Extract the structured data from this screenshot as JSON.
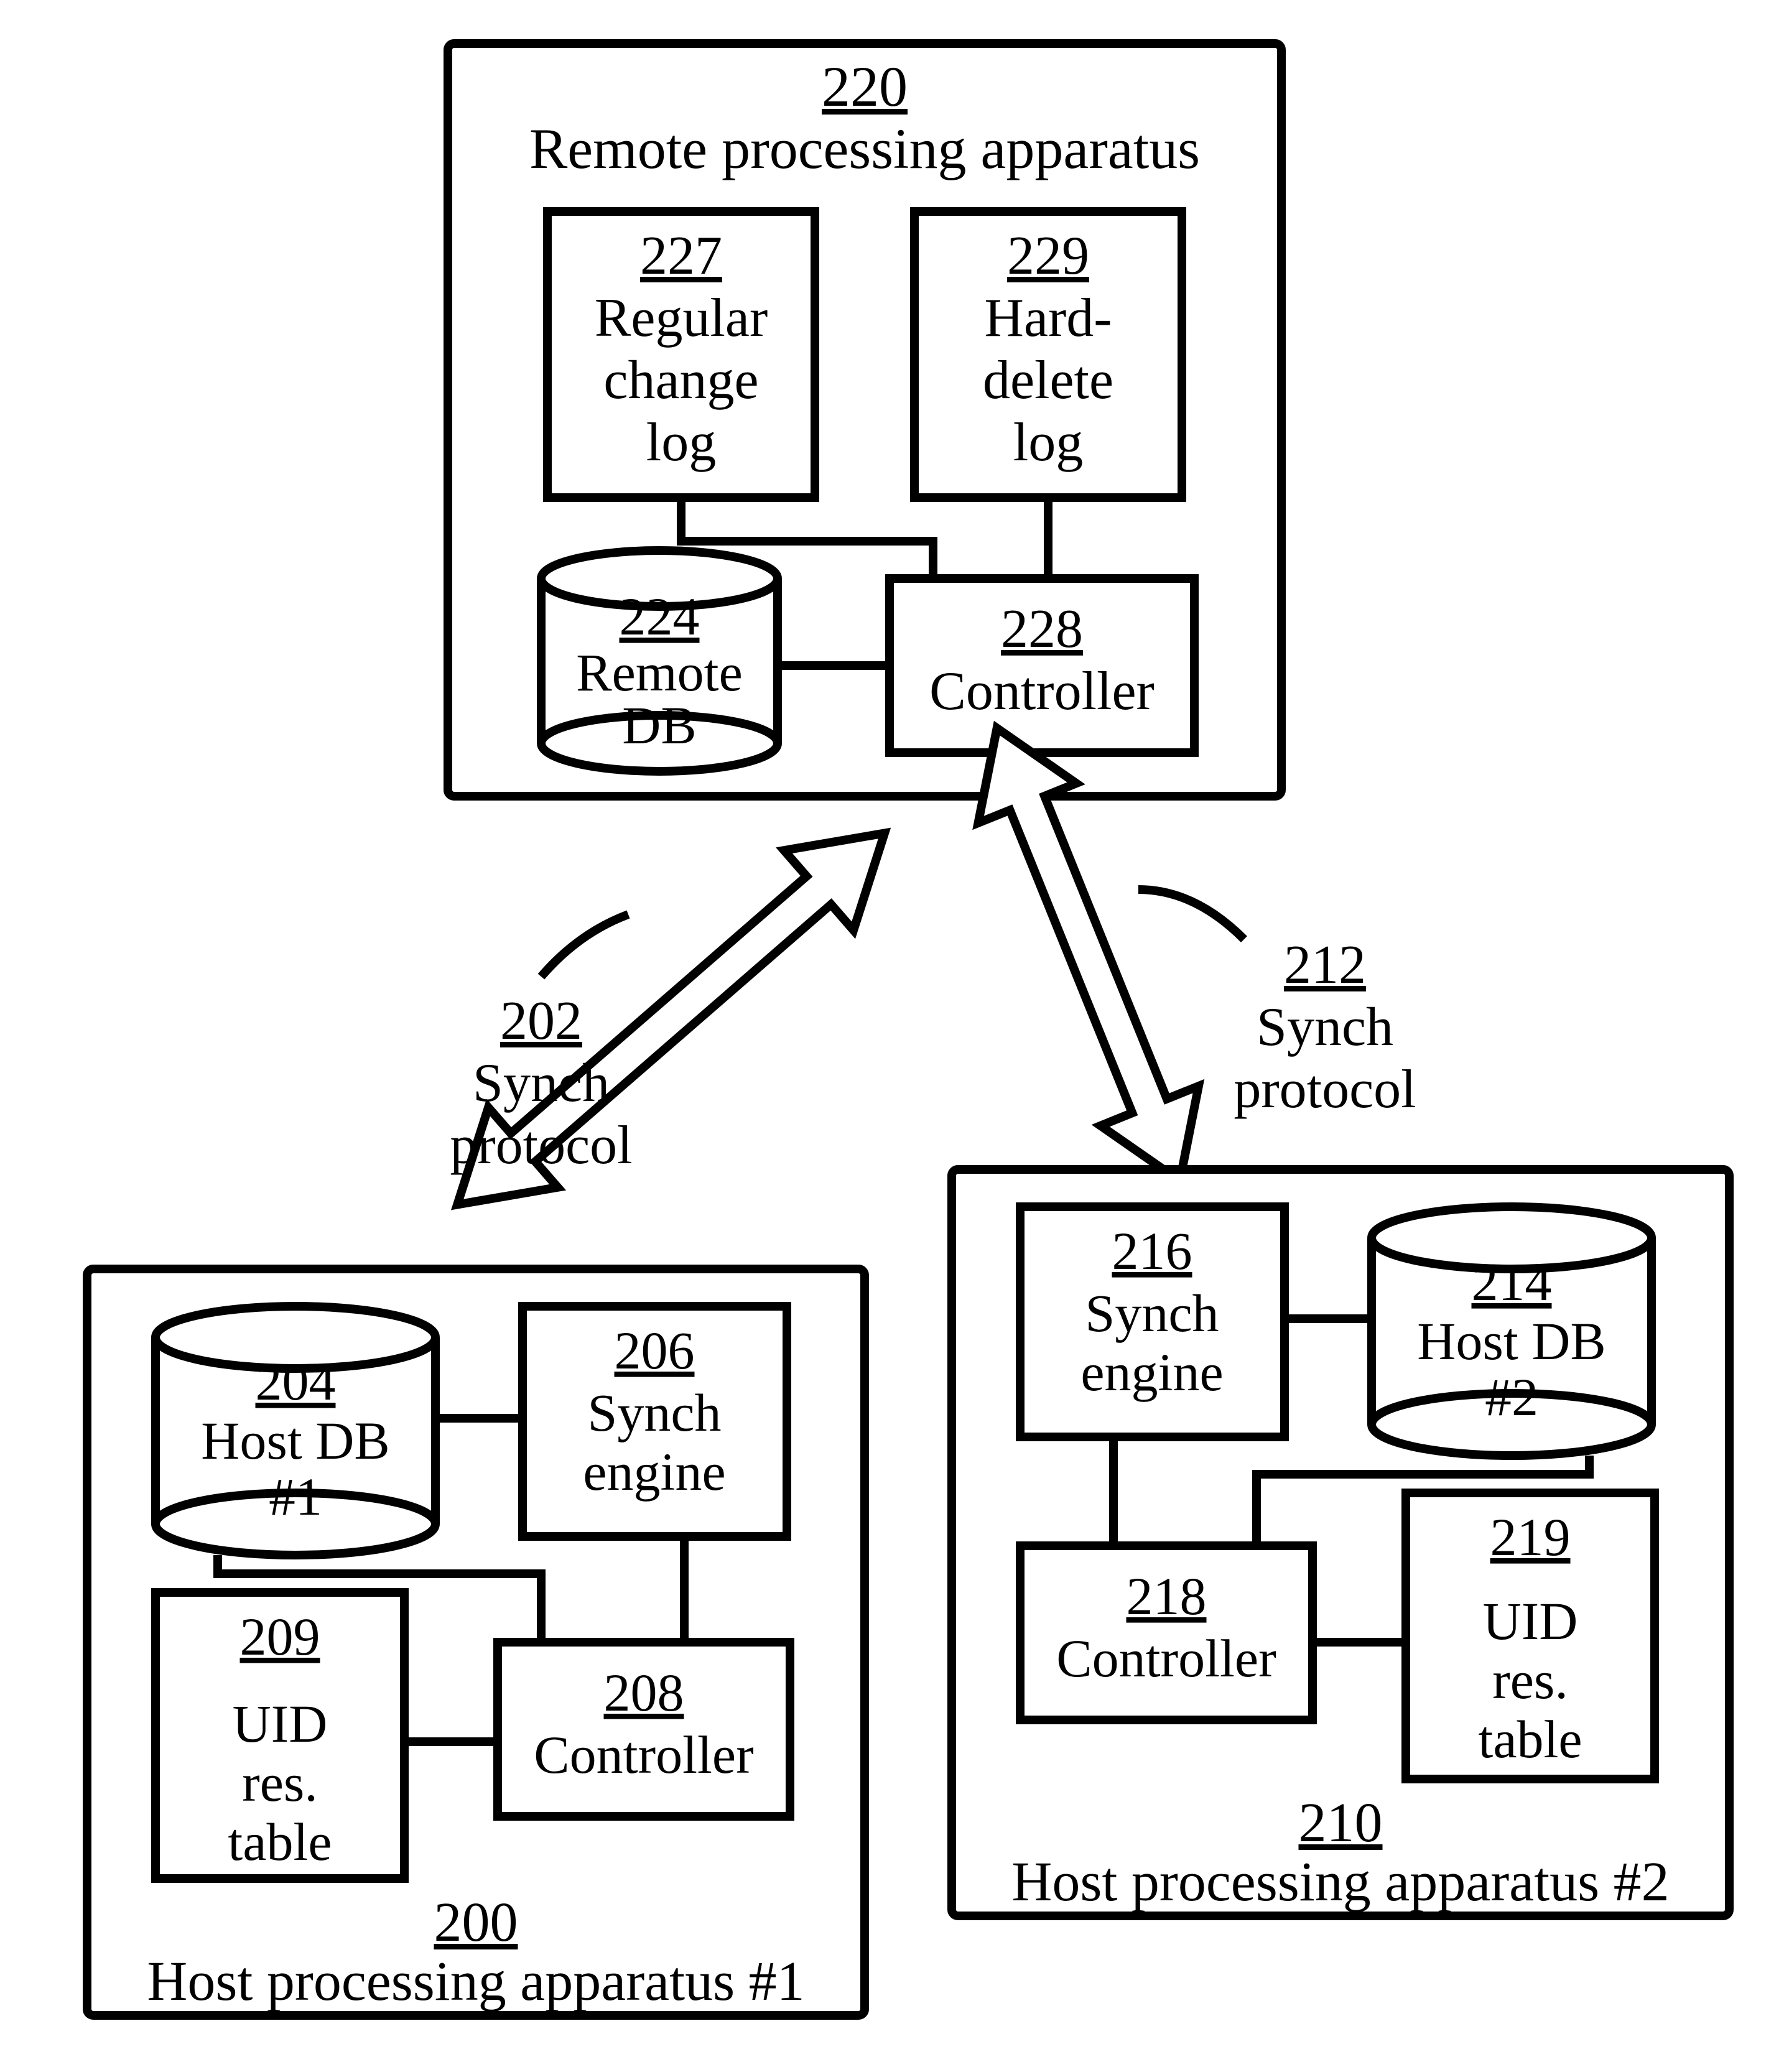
{
  "remote": {
    "ref": "220",
    "title": "Remote processing apparatus",
    "regLog": {
      "ref": "227",
      "l1": "Regular",
      "l2": "change",
      "l3": "log"
    },
    "hardLog": {
      "ref": "229",
      "l1": "Hard-",
      "l2": "delete",
      "l3": "log"
    },
    "db": {
      "ref": "224",
      "l1": "Remote",
      "l2": "DB"
    },
    "ctrl": {
      "ref": "228",
      "l1": "Controller"
    }
  },
  "arrow1": {
    "ref": "202",
    "l1": "Synch",
    "l2": "protocol"
  },
  "arrow2": {
    "ref": "212",
    "l1": "Synch",
    "l2": "protocol"
  },
  "host1": {
    "ref": "200",
    "title": "Host processing apparatus #1",
    "db": {
      "ref": "204",
      "l1": "Host DB",
      "l2": "#1"
    },
    "sync": {
      "ref": "206",
      "l1": "Synch",
      "l2": "engine"
    },
    "uid": {
      "ref": "209",
      "l1": "UID",
      "l2": "res.",
      "l3": "table"
    },
    "ctrl": {
      "ref": "208",
      "l1": "Controller"
    }
  },
  "host2": {
    "ref": "210",
    "title": "Host processing apparatus #2",
    "sync": {
      "ref": "216",
      "l1": "Synch",
      "l2": "engine"
    },
    "db": {
      "ref": "214",
      "l1": "Host DB",
      "l2": "#2"
    },
    "ctrl": {
      "ref": "218",
      "l1": "Controller"
    },
    "uid": {
      "ref": "219",
      "l1": "UID",
      "l2": "res.",
      "l3": "table"
    }
  }
}
